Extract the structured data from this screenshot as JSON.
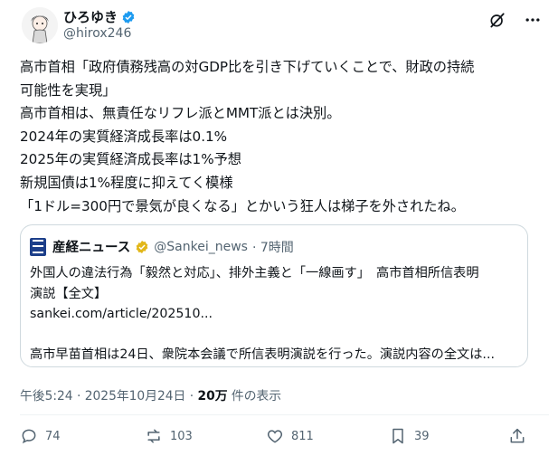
{
  "author": {
    "name": "ひろゆき",
    "handle": "@hirox246"
  },
  "tweet": {
    "text": "高市首相「政府債務残高の対GDP比を引き下げていくことで、財政の持続\n可能性を実現」\n高市首相は、無責任なリフレ派とMMT派とは決別。\n2024年の実質経済成長率は0.1%\n2025年の実質経済成長率は1%予想\n新規国債は1%程度に抑えてく模様\n「1ドル=300円で景気が良くなる」とかいう狂人は梯子を外されたね。"
  },
  "quote": {
    "name": "産経ニュース",
    "handle": "@Sankei_news",
    "time": "· 7時間",
    "text": "外国人の違法行為「毅然と対応」、排外主義と「一線画す」　高市首相所信表明\n演説【全文】\nsankei.com/article/202510...\n\n高市早苗首相は24日、衆院本会議で所信表明演説を行った。演説内容の全文は..."
  },
  "meta": {
    "datetime": "午後5:24 · 2025年10月24日 · ",
    "views": "20万",
    "views_suffix": " 件の表示"
  },
  "actions": {
    "replies": "74",
    "reposts": "103",
    "likes": "811",
    "bookmarks": "39"
  },
  "colors": {
    "verified": "#1d9bf0",
    "gold_badge": "#e2b719",
    "secondary_text": "#536471"
  }
}
